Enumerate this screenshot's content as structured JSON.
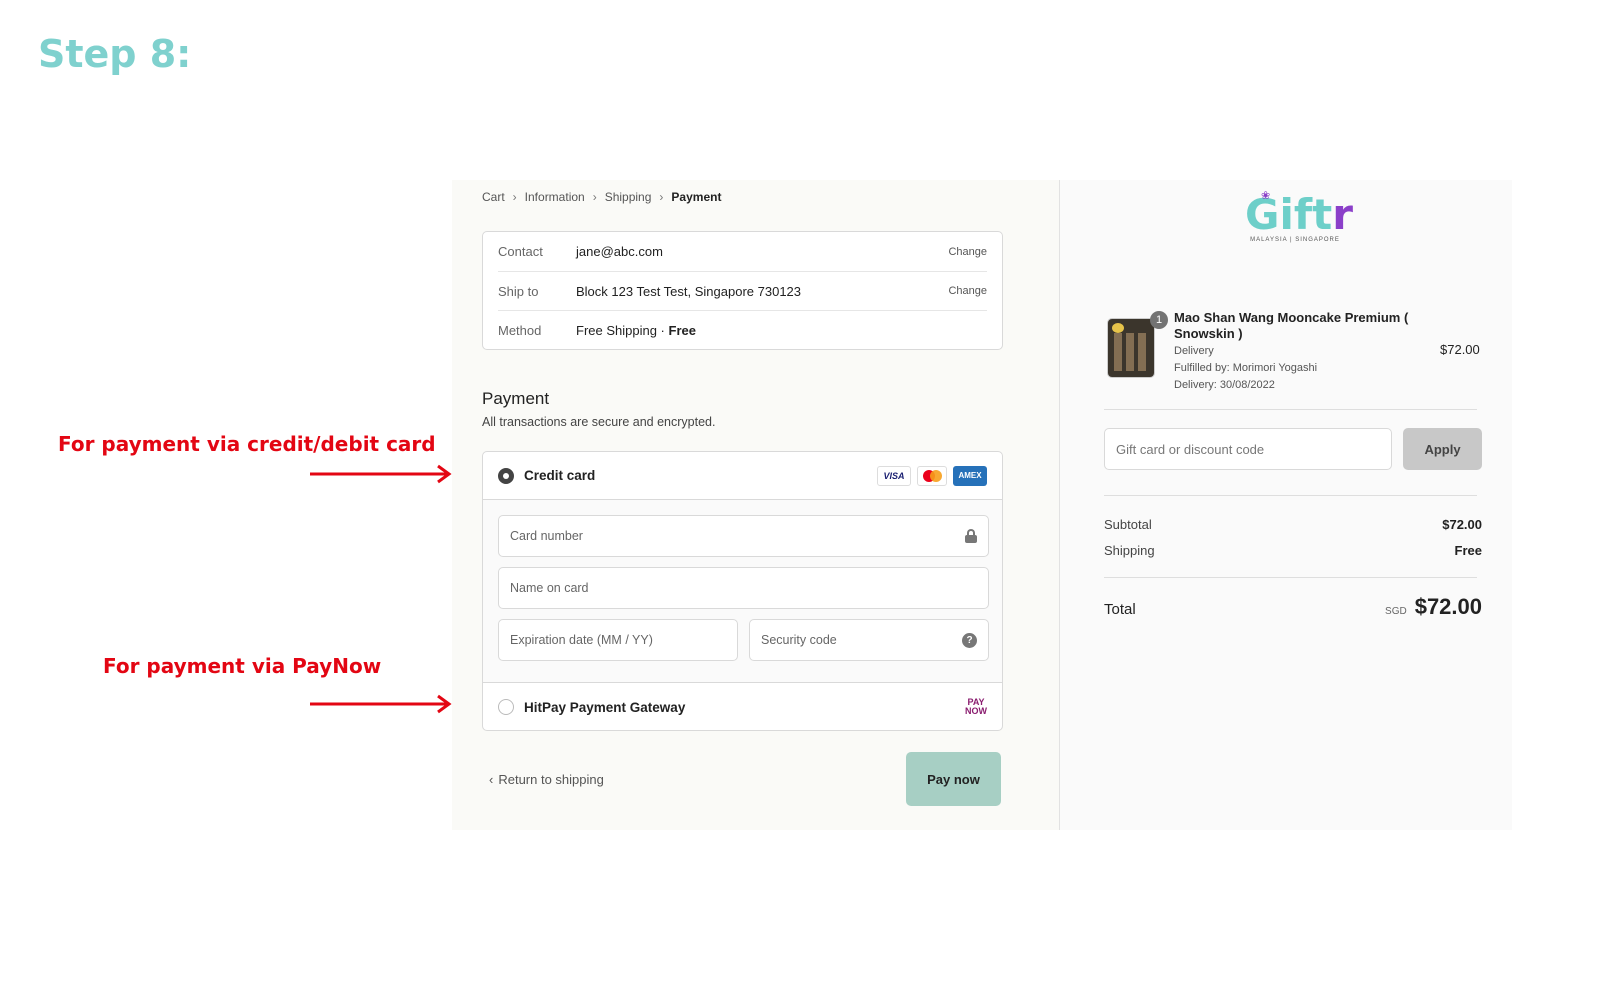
{
  "step_title": "Step 8:",
  "annotations": {
    "card": "For payment via credit/debit card",
    "paynow": "For payment via PayNow",
    "accent_color": "#e30613"
  },
  "breadcrumb": {
    "items": [
      "Cart",
      "Information",
      "Shipping",
      "Payment"
    ],
    "current": "Payment"
  },
  "info": {
    "contact": {
      "label": "Contact",
      "value": "jane@abc.com",
      "action": "Change"
    },
    "ship_to": {
      "label": "Ship to",
      "value": "Block 123 Test Test, Singapore 730123",
      "action": "Change"
    },
    "method": {
      "label": "Method",
      "value": "Free Shipping · ",
      "value_bold": "Free"
    }
  },
  "payment": {
    "title": "Payment",
    "subtitle": "All transactions are secure and encrypted.",
    "credit_card": {
      "label": "Credit card",
      "brands": [
        "VISA",
        "mastercard-icon",
        "AMEX"
      ],
      "card_number_placeholder": "Card number",
      "name_placeholder": "Name on card",
      "expiry_placeholder": "Expiration date (MM / YY)",
      "security_placeholder": "Security code",
      "selected": true
    },
    "hitpay": {
      "label": "HitPay Payment Gateway",
      "logo_top": "PAY",
      "logo_bottom": "NOW",
      "selected": false
    }
  },
  "footer": {
    "return_label": "Return to shipping",
    "pay_label": "Pay now",
    "pay_color": "#a7cfc4"
  },
  "brand": {
    "logo_main": "G",
    "logo_mid": "ift",
    "logo_end": "r",
    "logo_sub": "MALAYSIA | SINGAPORE",
    "teal": "#6dcfc9",
    "purple": "#8b3fc9"
  },
  "order": {
    "item": {
      "quantity": "1",
      "name": "Mao Shan Wang Mooncake Premium ( Snowskin )",
      "type": "Delivery",
      "fulfilled": "Fulfilled by: Morimori Yogashi",
      "delivery_date": "Delivery: 30/08/2022",
      "price": "$72.00"
    },
    "discount_placeholder": "Gift card or discount code",
    "apply_label": "Apply",
    "subtotal_label": "Subtotal",
    "subtotal_value": "$72.00",
    "shipping_label": "Shipping",
    "shipping_value": "Free",
    "total_label": "Total",
    "total_currency": "SGD",
    "total_value": "$72.00"
  }
}
